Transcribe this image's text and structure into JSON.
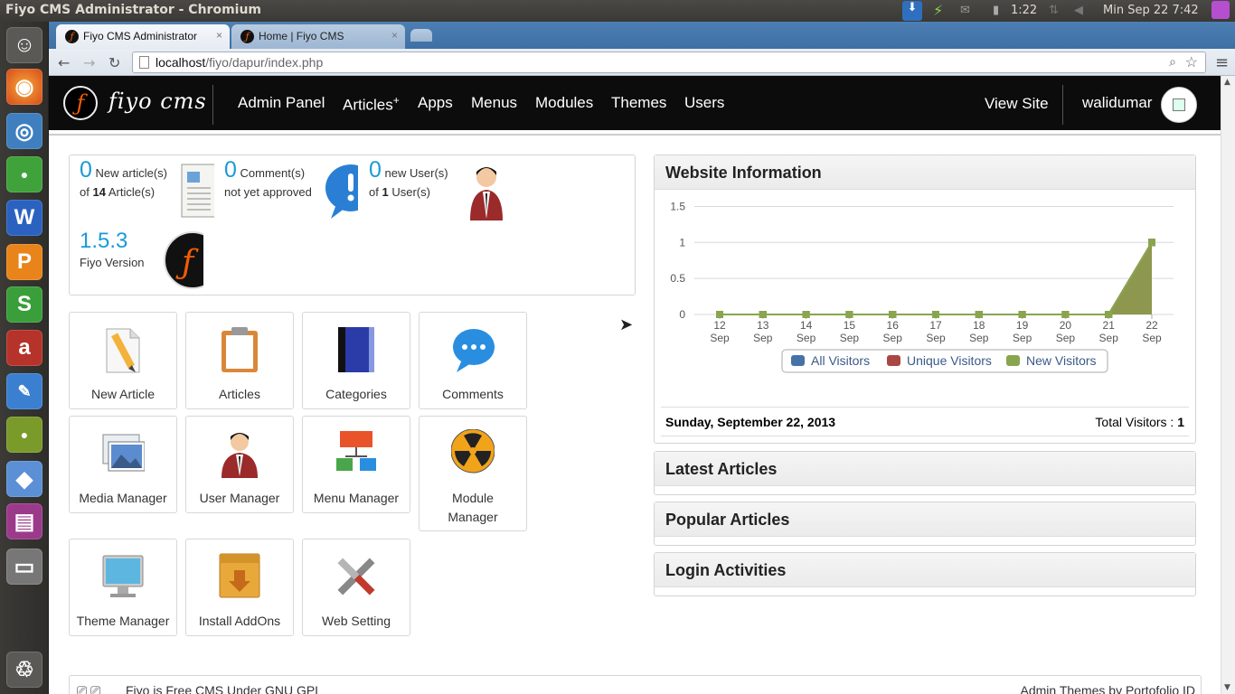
{
  "os": {
    "window_title": "Fiyo CMS Administrator - Chromium",
    "battery_time": "1:22",
    "clock": "Min Sep 22  7:42"
  },
  "browser": {
    "tabs": [
      {
        "label": "Fiyo CMS Administrator",
        "close": "×"
      },
      {
        "label": "Home | Fiyo CMS",
        "close": "×"
      }
    ],
    "url_host": "localhost",
    "url_path": "/fiyo/dapur/index.php"
  },
  "header": {
    "brand": "fiyo cms",
    "nav": [
      "Admin Panel",
      "Articles",
      "Apps",
      "Menus",
      "Modules",
      "Themes",
      "Users"
    ],
    "nav_sup": "+",
    "view_site": "View Site",
    "username": "walidumar"
  },
  "stats": {
    "articles": {
      "count": "0",
      "label": "New article(s)",
      "of": "of",
      "total": "14",
      "total_label": "Article(s)"
    },
    "comments": {
      "count": "0",
      "label": "Comment(s)",
      "sub": "not yet approved"
    },
    "users": {
      "count": "0",
      "label": "new User(s)",
      "of": "of",
      "total": "1",
      "total_label": "User(s)"
    },
    "version": {
      "value": "1.5.3",
      "label": "Fiyo Version"
    }
  },
  "tiles": [
    {
      "label": "New Article",
      "icon": "pencil-document-icon"
    },
    {
      "label": "Articles",
      "icon": "clipboard-icon"
    },
    {
      "label": "Categories",
      "icon": "book-icon"
    },
    {
      "label": "Comments",
      "icon": "speech-bubble-icon"
    },
    {
      "label": "Media Manager",
      "icon": "pictures-icon"
    },
    {
      "label": "User Manager",
      "icon": "user-icon"
    },
    {
      "label": "Menu Manager",
      "icon": "sitemap-icon"
    },
    {
      "label": "Module Manager",
      "icon": "radiation-icon"
    },
    {
      "label": "Theme Manager",
      "icon": "monitor-icon"
    },
    {
      "label": "Install AddOns",
      "icon": "package-icon"
    },
    {
      "label": "Web Setting",
      "icon": "tools-icon"
    }
  ],
  "panels": {
    "website_info": "Website Information",
    "latest_articles": "Latest Articles",
    "popular_articles": "Popular Articles",
    "login_activities": "Login Activities",
    "date": "Sunday, September 22, 2013",
    "total_label": "Total Visitors : ",
    "total_value": "1"
  },
  "chart_data": {
    "type": "area",
    "categories": [
      "12 Sep",
      "13 Sep",
      "14 Sep",
      "15 Sep",
      "16 Sep",
      "17 Sep",
      "18 Sep",
      "19 Sep",
      "20 Sep",
      "21 Sep",
      "22 Sep"
    ],
    "x_ticks": [
      [
        "12",
        "Sep"
      ],
      [
        "13",
        "Sep"
      ],
      [
        "14",
        "Sep"
      ],
      [
        "15",
        "Sep"
      ],
      [
        "16",
        "Sep"
      ],
      [
        "17",
        "Sep"
      ],
      [
        "18",
        "Sep"
      ],
      [
        "19",
        "Sep"
      ],
      [
        "20",
        "Sep"
      ],
      [
        "21",
        "Sep"
      ],
      [
        "22",
        "Sep"
      ]
    ],
    "y_ticks": [
      "0",
      "0.5",
      "1",
      "1.5"
    ],
    "ylim": [
      0,
      1.5
    ],
    "series": [
      {
        "name": "All Visitors",
        "color": "#4572a7",
        "values": [
          0,
          0,
          0,
          0,
          0,
          0,
          0,
          0,
          0,
          0,
          1
        ]
      },
      {
        "name": "Unique Visitors",
        "color": "#aa4643",
        "values": [
          0,
          0,
          0,
          0,
          0,
          0,
          0,
          0,
          0,
          0,
          1
        ]
      },
      {
        "name": "New Visitors",
        "color": "#89a54e",
        "values": [
          0,
          0,
          0,
          0,
          0,
          0,
          0,
          0,
          0,
          0,
          1
        ]
      }
    ],
    "legend_position": "bottom-center",
    "grid": true
  },
  "footer": {
    "left": "Fiyo is Free CMS Under GNU GPL",
    "right": "Admin Themes by Portofolio ID"
  }
}
